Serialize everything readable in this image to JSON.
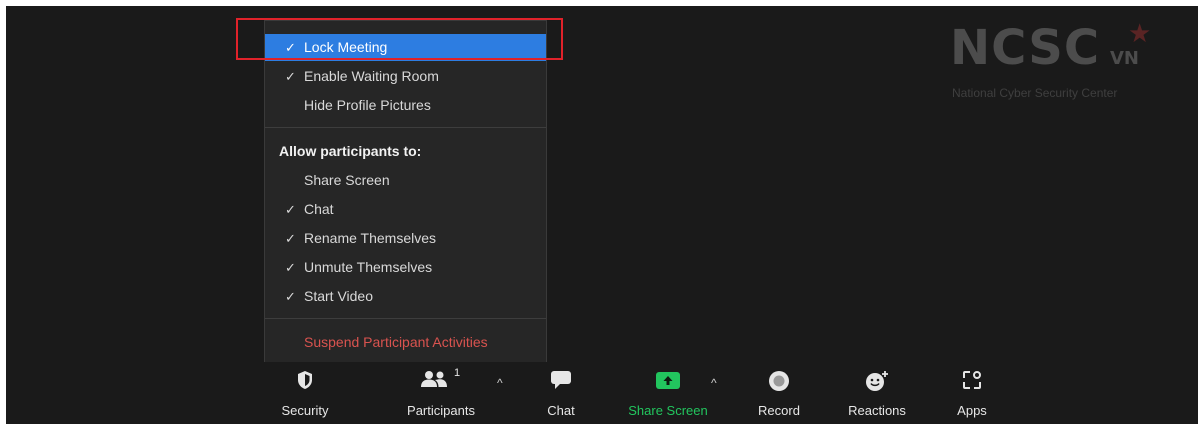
{
  "watermark": {
    "logo": "NCSC",
    "suffix": "VN",
    "subtitle": "National Cyber Security Center"
  },
  "security_menu": {
    "items": [
      {
        "label": "Lock Meeting",
        "checked": true,
        "selected": true
      },
      {
        "label": "Enable Waiting Room",
        "checked": true
      },
      {
        "label": "Hide Profile Pictures",
        "checked": false
      }
    ],
    "section_header": "Allow participants to:",
    "permissions": [
      {
        "label": "Share Screen",
        "checked": false
      },
      {
        "label": "Chat",
        "checked": true
      },
      {
        "label": "Rename Themselves",
        "checked": true
      },
      {
        "label": "Unmute Themselves",
        "checked": true
      },
      {
        "label": "Start Video",
        "checked": true
      }
    ],
    "suspend_label": "Suspend Participant Activities",
    "check_glyph": "✓"
  },
  "toolbar": {
    "security": {
      "label": "Security",
      "icon": "shield-icon"
    },
    "participants": {
      "label": "Participants",
      "count": "1",
      "icon": "participants-icon"
    },
    "chat": {
      "label": "Chat",
      "icon": "chat-icon"
    },
    "share_screen": {
      "label": "Share Screen",
      "icon": "share-screen-icon"
    },
    "record": {
      "label": "Record",
      "icon": "record-icon"
    },
    "reactions": {
      "label": "Reactions",
      "icon": "reactions-icon"
    },
    "apps": {
      "label": "Apps",
      "icon": "apps-icon"
    },
    "caret_glyph": "^"
  },
  "colors": {
    "accent": "#2d7de1",
    "share_green": "#22c55e",
    "danger": "#d9534f",
    "highlight_red": "#e0222a"
  }
}
